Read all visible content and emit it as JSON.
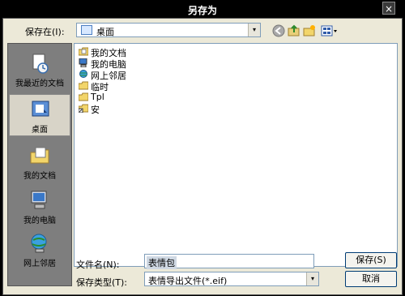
{
  "window": {
    "title": "另存为",
    "close_glyph": "×"
  },
  "lookin": {
    "label": "保存在(I):",
    "value": "桌面",
    "arrow": "▾"
  },
  "toolbar": {
    "icons": [
      "back-icon",
      "up-folder-icon",
      "new-folder-icon",
      "views-menu-icon"
    ],
    "views_arrow": "▾"
  },
  "places": [
    {
      "label": "我最近的文档",
      "icon": "recent-documents-icon",
      "active": false
    },
    {
      "label": "桌面",
      "icon": "desktop-icon",
      "active": true
    },
    {
      "label": "我的文档",
      "icon": "my-documents-icon",
      "active": false
    },
    {
      "label": "我的电脑",
      "icon": "my-computer-icon",
      "active": false
    },
    {
      "label": "网上邻居",
      "icon": "network-places-icon",
      "active": false
    }
  ],
  "files": [
    {
      "name": "我的文档",
      "icon": "documents-folder-icon"
    },
    {
      "name": "我的电脑",
      "icon": "computer-icon"
    },
    {
      "name": "网上邻居",
      "icon": "network-icon"
    },
    {
      "name": "临时",
      "icon": "folder-icon"
    },
    {
      "name": "Tpl",
      "icon": "folder-icon"
    },
    {
      "name": "安",
      "icon": "shortcut-folder-icon"
    }
  ],
  "filename": {
    "label": "文件名(N):",
    "value": "表情包"
  },
  "filetype": {
    "label": "保存类型(T):",
    "value": "表情导出文件(*.eif)",
    "arrow": "▾"
  },
  "buttons": {
    "save": "保存(S)",
    "cancel": "取消"
  }
}
